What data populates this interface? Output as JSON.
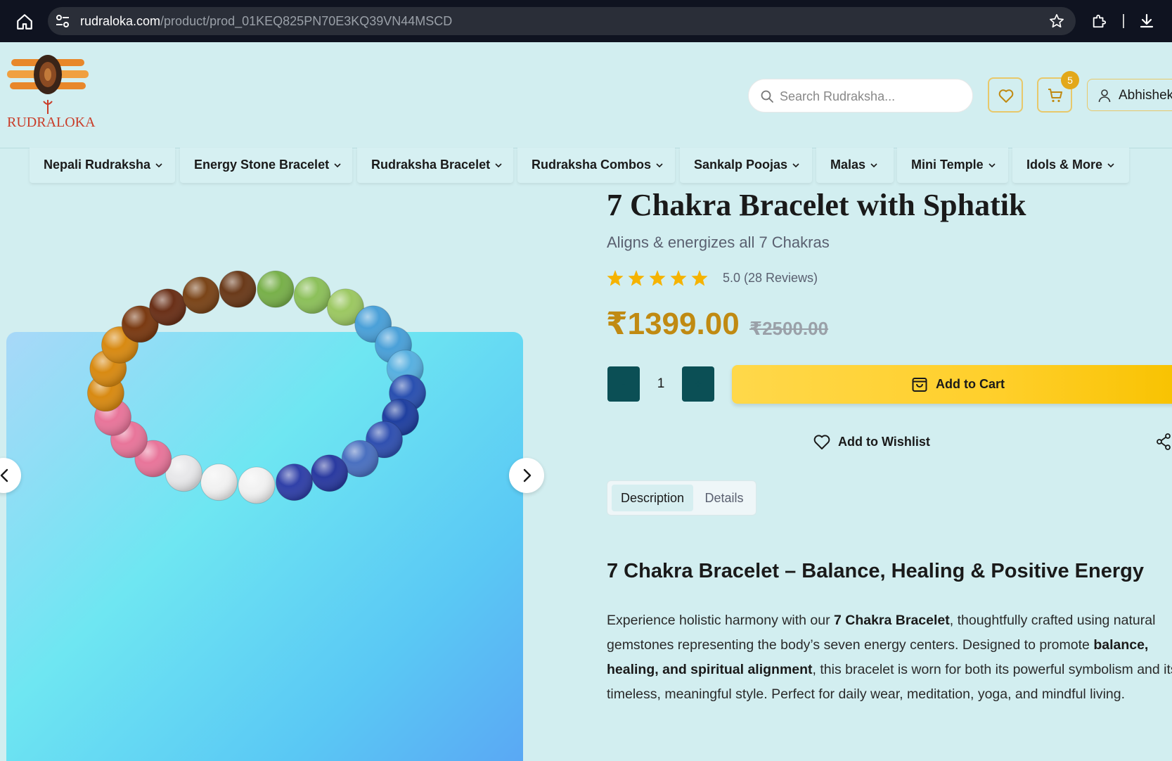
{
  "browser": {
    "url_host": "rudraloka.com",
    "url_path": "/product/prod_01KEQ825PN70E3KQ39VN44MSCD"
  },
  "header": {
    "logo_text": "RUDRALOKA",
    "search_placeholder": "Search Rudraksha...",
    "cart_count": "5",
    "user_name": "Abhishek"
  },
  "nav": {
    "items": [
      {
        "label": "Nepali Rudraksha"
      },
      {
        "label": "Energy Stone Bracelet"
      },
      {
        "label": "Rudraksha Bracelet"
      },
      {
        "label": "Rudraksha Combos"
      },
      {
        "label": "Sankalp Poojas"
      },
      {
        "label": "Malas"
      },
      {
        "label": "Mini Temple"
      },
      {
        "label": "Idols & More"
      }
    ]
  },
  "product": {
    "title": "7 Chakra Bracelet with Sphatik",
    "subtitle": "Aligns & energizes all 7 Chakras",
    "rating": 5.0,
    "rating_text": "5.0 (28 Reviews)",
    "price": "₹1399.00",
    "mrp": "₹2500.00",
    "quantity": "1",
    "minus_label": "-",
    "plus_label": "+",
    "add_to_cart_label": "Add to Cart",
    "add_to_wishlist_label": "Add to Wishlist"
  },
  "tabs": [
    {
      "label": "Description",
      "active": true
    },
    {
      "label": "Details",
      "active": false
    }
  ],
  "description": {
    "heading": "7 Chakra Bracelet – Balance, Healing & Positive Energy",
    "p1_a": "Experience holistic harmony with our ",
    "p1_b": "7 Chakra Bracelet",
    "p1_c": ", thoughtfully crafted using natural gemstones representing the body’s seven energy centers. Designed to promote ",
    "p1_d": "balance, healing, and spiritual alignment",
    "p1_e": ", this bracelet is worn for both its powerful symbolism and its timeless, meaningful style. Perfect for daily wear, meditation, yoga, and mindful living."
  },
  "colors": {
    "page_bg": "#d2eef0",
    "price": "#c08a12",
    "accent_yellow": "#ffcf2a",
    "qty_button": "#0b4f55",
    "badge": "#e3a81a"
  },
  "icons": [
    "home-icon",
    "site-info-icon",
    "bookmark-star-icon",
    "extensions-icon",
    "download-icon",
    "search-icon",
    "heart-icon",
    "cart-icon",
    "user-icon",
    "chevron-down-icon",
    "chevron-left-icon",
    "chevron-right-icon",
    "star-icon",
    "bag-icon",
    "share-icon"
  ]
}
